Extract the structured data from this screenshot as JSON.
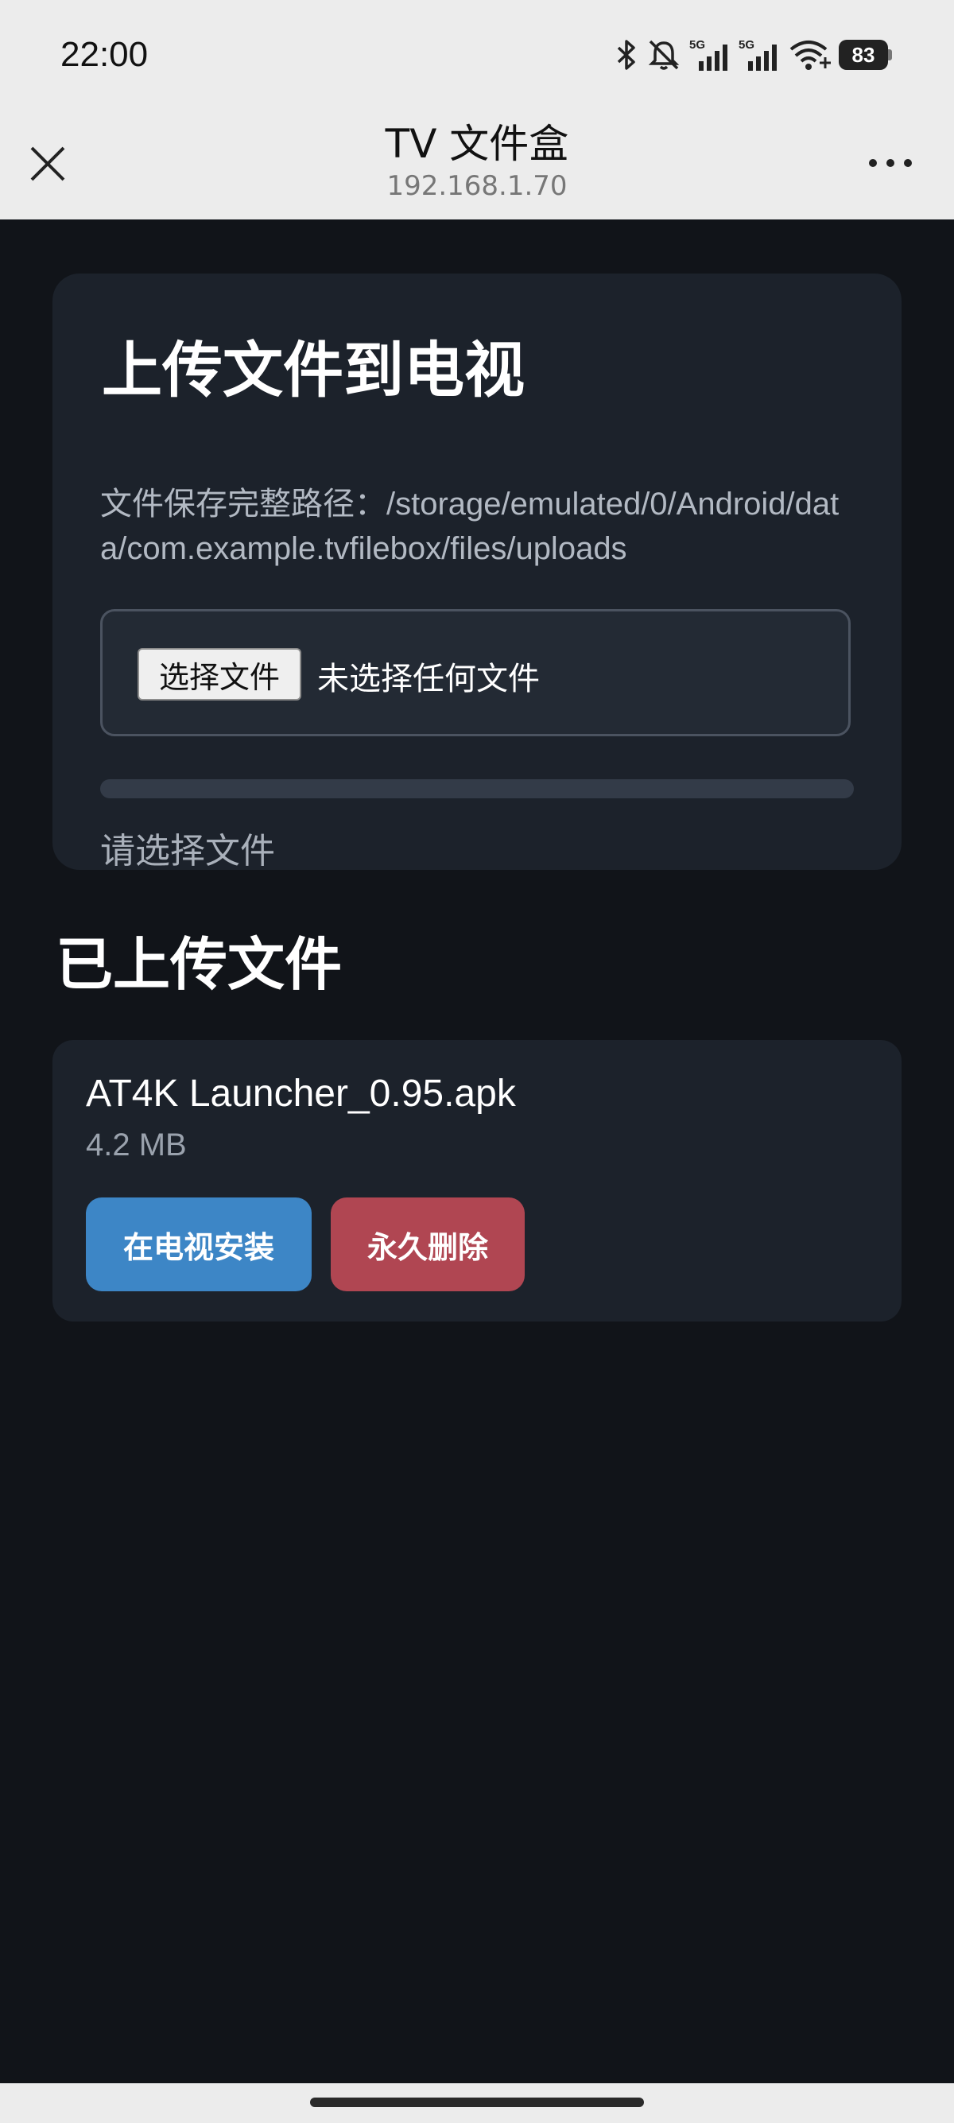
{
  "status_bar": {
    "time": "22:00",
    "network_1": "5G",
    "network_2": "5G",
    "battery": "83"
  },
  "header": {
    "title": "TV 文件盒",
    "subtitle": "192.168.1.70"
  },
  "upload": {
    "title": "上传文件到电视",
    "path_label": "文件保存完整路径：/storage/emulated/0/Android/data/com.example.tvfilebox/files/uploads",
    "choose_button": "选择文件",
    "no_file_text": "未选择任何文件",
    "progress_fraction": 0,
    "status": "请选择文件"
  },
  "uploaded": {
    "heading": "已上传文件",
    "files": [
      {
        "name": "AT4K Launcher_0.95.apk",
        "size": "4.2 MB",
        "install_label": "在电视安装",
        "delete_label": "永久删除"
      }
    ]
  },
  "colors": {
    "accent_blue": "#3d86c6",
    "danger_red": "#b04652",
    "page_bg": "#111419",
    "card_bg": "#1c222b"
  }
}
